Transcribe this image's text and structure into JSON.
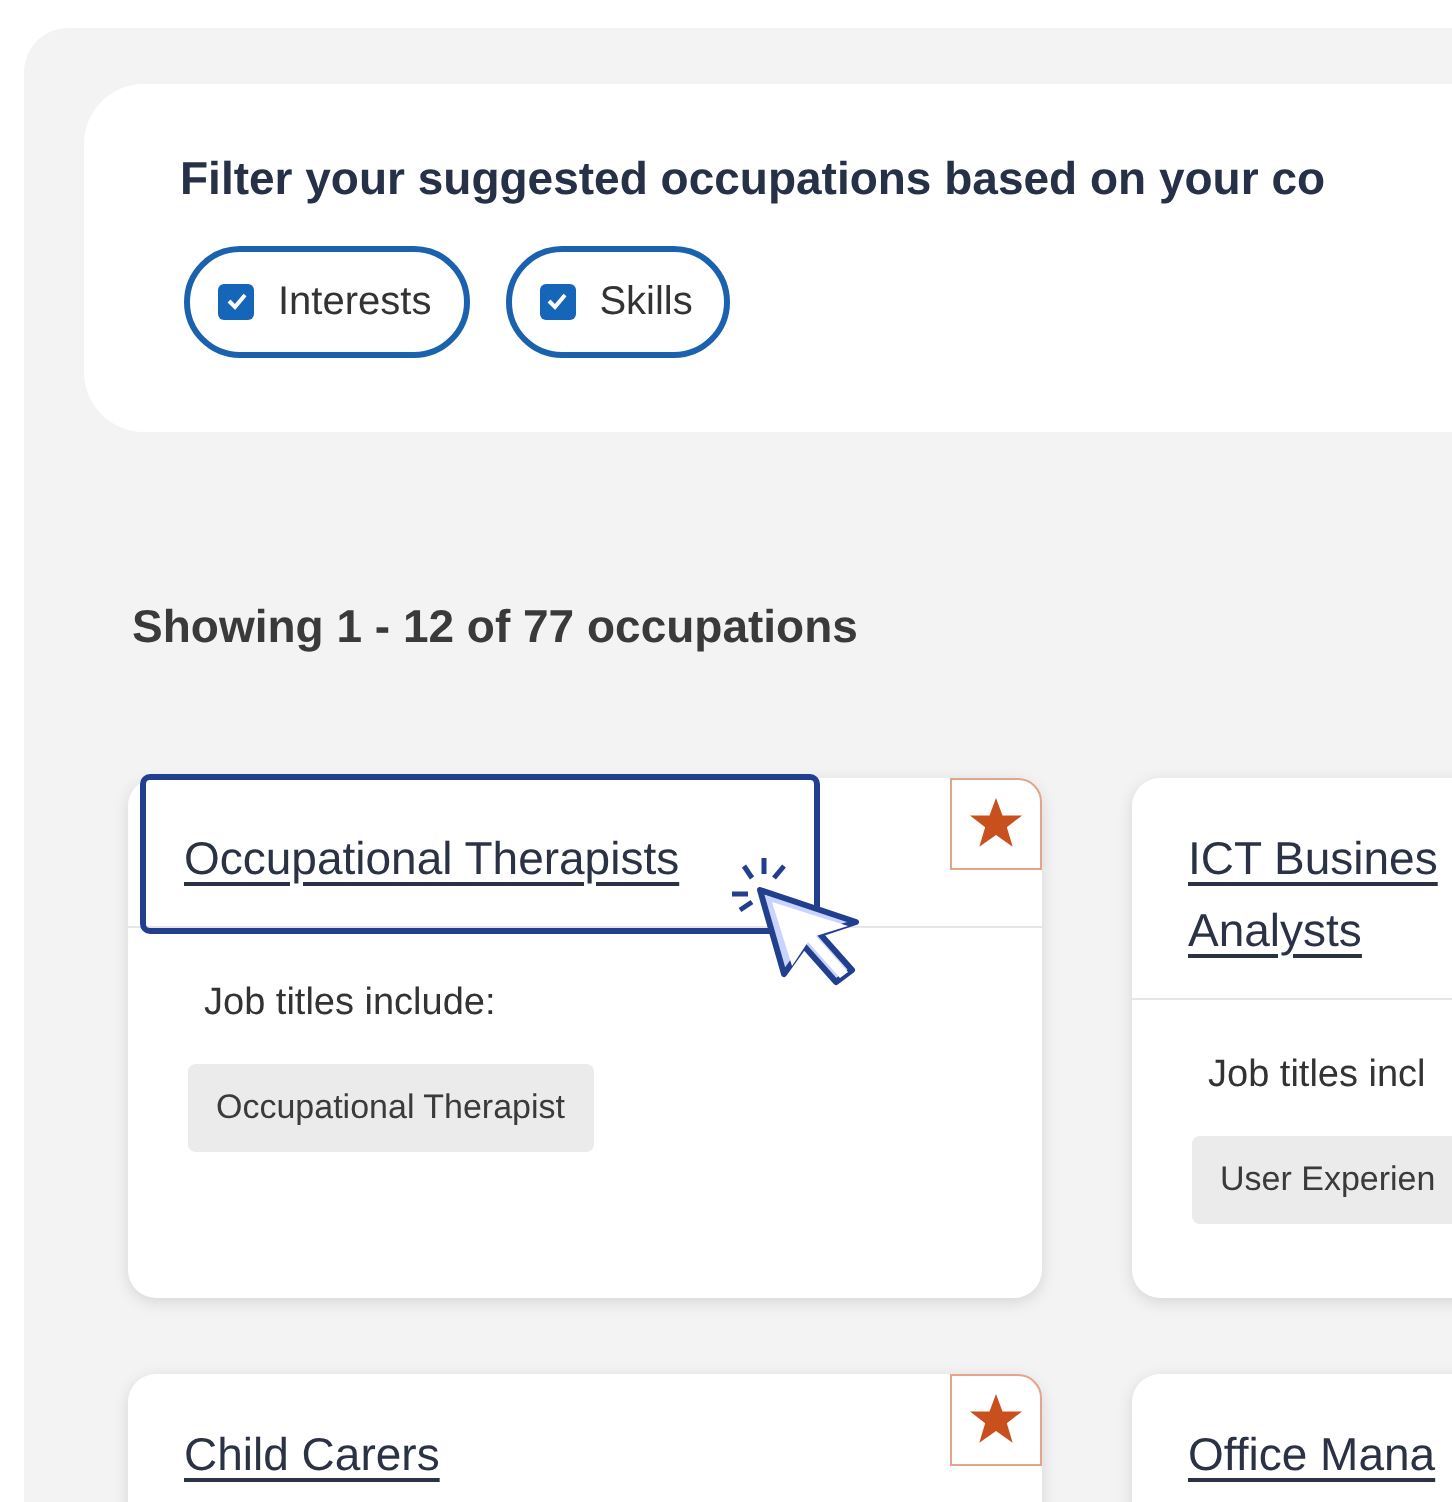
{
  "filter": {
    "heading": "Filter your suggested occupations based on your co",
    "options": [
      {
        "label": "Interests",
        "checked": true
      },
      {
        "label": "Skills",
        "checked": true
      }
    ]
  },
  "results_summary": "Showing 1 - 12 of 77 occupations",
  "cards": [
    {
      "title": [
        "Occupational Therapists"
      ],
      "focused": true,
      "starred": true,
      "job_titles_label": "Job titles include:",
      "job_titles": [
        "Occupational Therapist"
      ]
    },
    {
      "title": [
        "ICT Busines",
        "Analysts"
      ],
      "focused": false,
      "job_titles_label": "Job titles incl",
      "job_titles": [
        "User Experien"
      ]
    },
    {
      "title": [
        "Child Carers"
      ],
      "focused": false,
      "starred": true
    },
    {
      "title": [
        "Office Mana"
      ],
      "focused": false
    }
  ]
}
